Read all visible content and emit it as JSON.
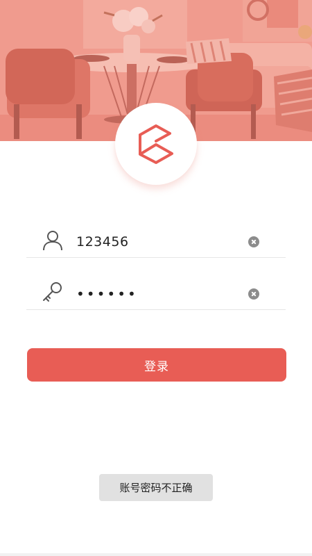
{
  "login": {
    "username_value": "123456",
    "password_display": "••••••",
    "submit_label": "登录"
  },
  "toast": {
    "message": "账号密码不正确"
  },
  "icons": {
    "user": "user-icon",
    "password": "key-icon",
    "clear": "clear-icon",
    "logo": "app-logo-icon"
  },
  "colors": {
    "accent": "#e85d55",
    "banner_tint": "#ee9587",
    "toast_bg": "#e1e1e1"
  }
}
